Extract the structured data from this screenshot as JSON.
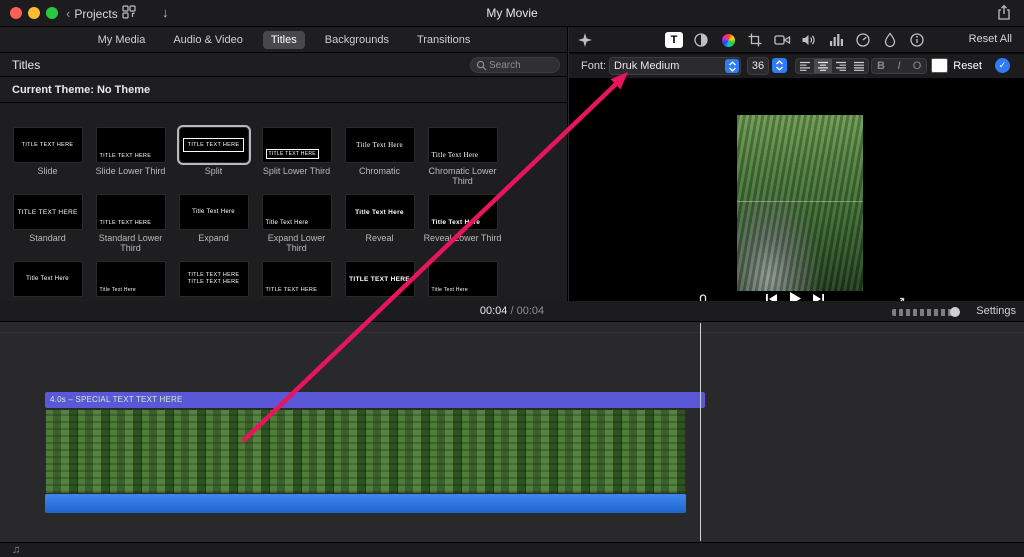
{
  "window": {
    "projects_label": "Projects",
    "title": "My Movie"
  },
  "glyphs": {
    "chevron_left": "‹",
    "import_arrow": "↓",
    "music_note": "♫",
    "check": "✓"
  },
  "tabs": {
    "items": [
      {
        "label": "My Media"
      },
      {
        "label": "Audio & Video"
      },
      {
        "label": "Titles"
      },
      {
        "label": "Backgrounds"
      },
      {
        "label": "Transitions"
      }
    ]
  },
  "browser": {
    "header": "Titles",
    "search_placeholder": "Search",
    "theme_label": "Current Theme: No Theme",
    "titles": [
      {
        "label": "Slide",
        "thumb": "TITLE TEXT HERE"
      },
      {
        "label": "Slide Lower Third",
        "thumb": "TITLE TEXT HERE"
      },
      {
        "label": "Split",
        "thumb": "TITLE TEXT HERE",
        "selected": true
      },
      {
        "label": "Split Lower Third",
        "thumb": "TITLE TEXT HERE"
      },
      {
        "label": "Chromatic",
        "thumb": "Title Text Here"
      },
      {
        "label": "Chromatic Lower Third",
        "thumb": "Title Text Here"
      },
      {
        "label": "Standard",
        "thumb": "TITLE TEXT HERE"
      },
      {
        "label": "Standard Lower Third",
        "thumb": "TITLE TEXT HERE"
      },
      {
        "label": "Expand",
        "thumb": "Title Text Here"
      },
      {
        "label": "Expand Lower Third",
        "thumb": "Title Text Here"
      },
      {
        "label": "Reveal",
        "thumb": "Title Text Here"
      },
      {
        "label": "Reveal Lower Third",
        "thumb": "Title Text Here"
      },
      {
        "label": "",
        "thumb": "Title Text Here"
      },
      {
        "label": "",
        "thumb": "Title Text Here"
      },
      {
        "label": "",
        "thumb": "TITLE TEXT HERE TITLE TEXT HERE"
      },
      {
        "label": "",
        "thumb": "TITLE TEXT HERE"
      },
      {
        "label": "",
        "thumb": "TITLE TEXT HERE"
      },
      {
        "label": "",
        "thumb": "Title Text Here"
      }
    ]
  },
  "inspector": {
    "reset_all": "Reset All",
    "font_label": "Font:",
    "font_name": "Druk Medium",
    "font_size": "36",
    "bold_label": "B",
    "italic_label": "I",
    "outline_label": "O",
    "reset_label": "Reset"
  },
  "timecode": {
    "current": "00:04",
    "divider": "/",
    "total": "00:04"
  },
  "timeline": {
    "settings_label": "Settings",
    "title_clip_label": "4.0s – SPECIAL TEXT TEXT HERE"
  },
  "colors": {
    "accent": "#2f7cf6",
    "arrow": "#e9155c",
    "title_clip": "#5b58d8",
    "audio_clip": "#2673e2",
    "selected_tab": "#48484c"
  }
}
